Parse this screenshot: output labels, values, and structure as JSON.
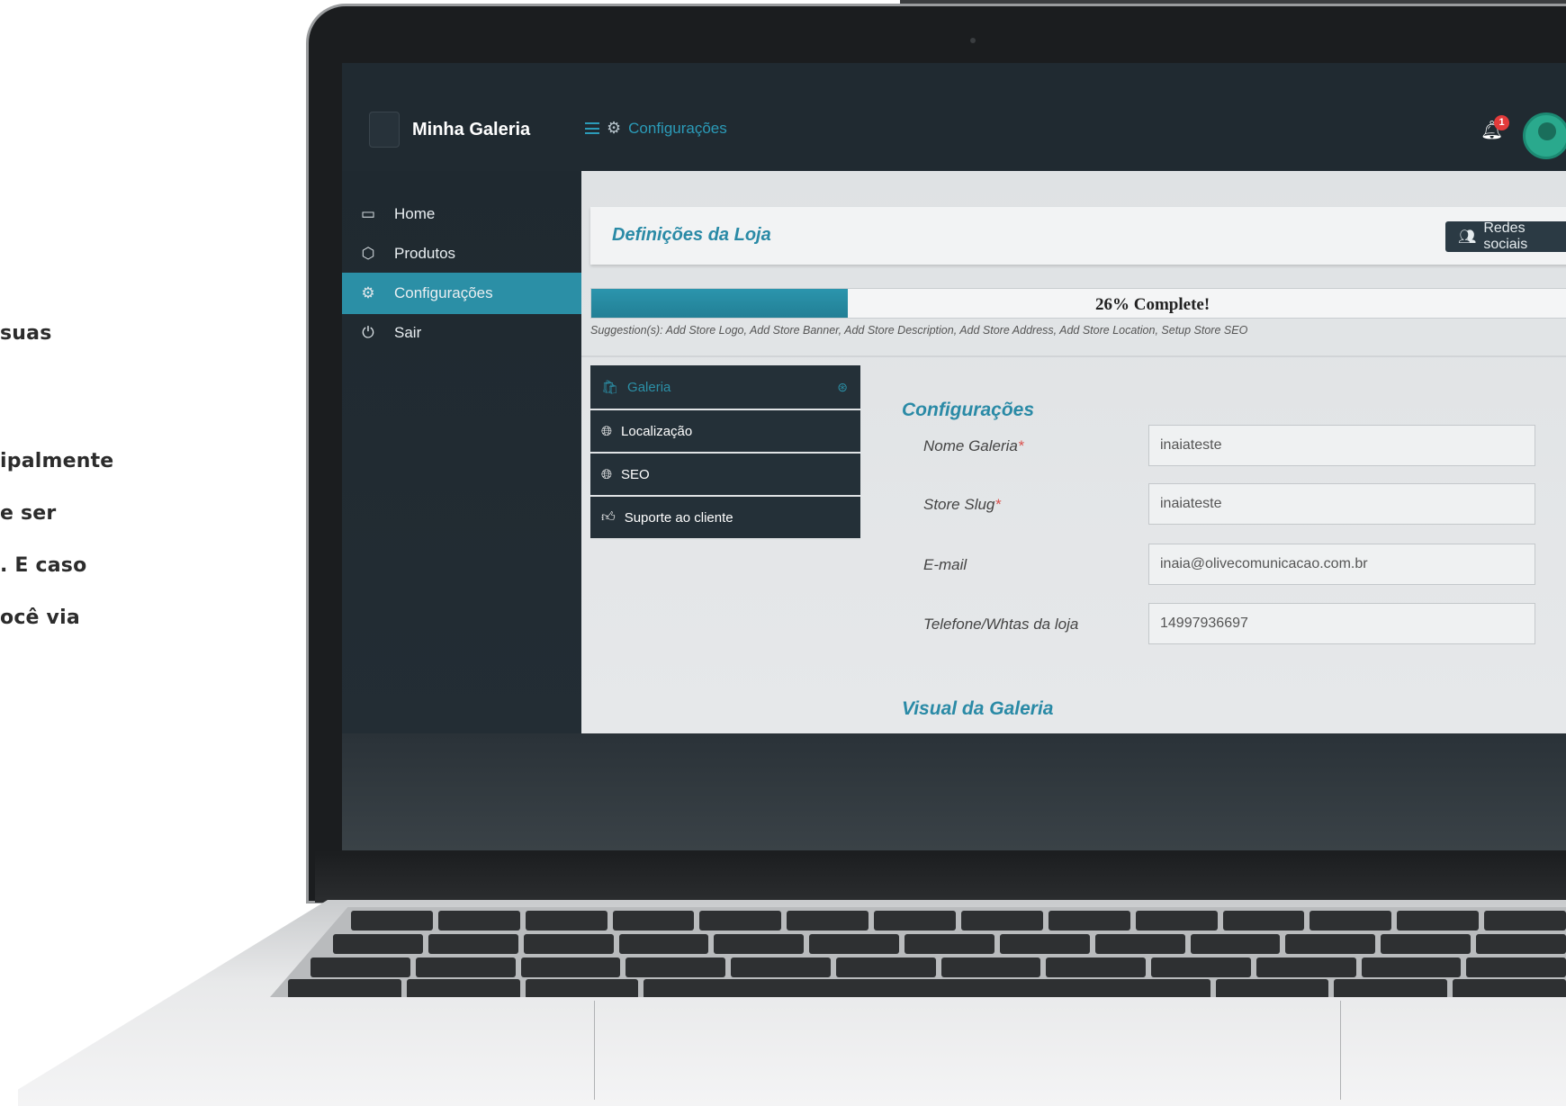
{
  "side_text": [
    "suas",
    "ipalmente",
    "e ser",
    ". E caso",
    "ocê via"
  ],
  "app": {
    "brand": "Minha Galeria",
    "breadcrumb": "Configurações",
    "notification_count": "1"
  },
  "sidebar": {
    "items": [
      {
        "label": "Home",
        "icon": "monitor-icon"
      },
      {
        "label": "Produtos",
        "icon": "box-icon"
      },
      {
        "label": "Configurações",
        "icon": "gears-icon",
        "active": true
      },
      {
        "label": "Sair",
        "icon": "power-icon"
      }
    ]
  },
  "main": {
    "title": "Definições da Loja",
    "social_button": "Redes sociais",
    "progress": {
      "percent": 26,
      "label": "26% Complete!"
    },
    "suggestions": "Suggestion(s): Add Store Logo, Add Store Banner, Add Store Description, Add Store Address, Add Store Location, Setup Store SEO",
    "tabs": [
      {
        "label": "Galeria",
        "icon": "bag-icon"
      },
      {
        "label": "Localização",
        "icon": "globe-icon"
      },
      {
        "label": "SEO",
        "icon": "globe-icon"
      },
      {
        "label": "Suporte ao cliente",
        "icon": "thumbs-up-icon"
      }
    ],
    "section_config": "Configurações",
    "fields": [
      {
        "label": "Nome Galeria",
        "required": true,
        "value": "inaiateste"
      },
      {
        "label": "Store Slug",
        "required": true,
        "value": "inaiateste"
      },
      {
        "label": "E-mail",
        "required": false,
        "value": "inaia@olivecomunicacao.com.br"
      },
      {
        "label": "Telefone/Whtas da loja",
        "required": false,
        "value": "14997936697"
      }
    ],
    "section_visual": "Visual da Galeria"
  },
  "colors": {
    "accent": "#2b8fa6",
    "sidebar_bg": "#1f2930",
    "badge": "#e33b3b"
  }
}
